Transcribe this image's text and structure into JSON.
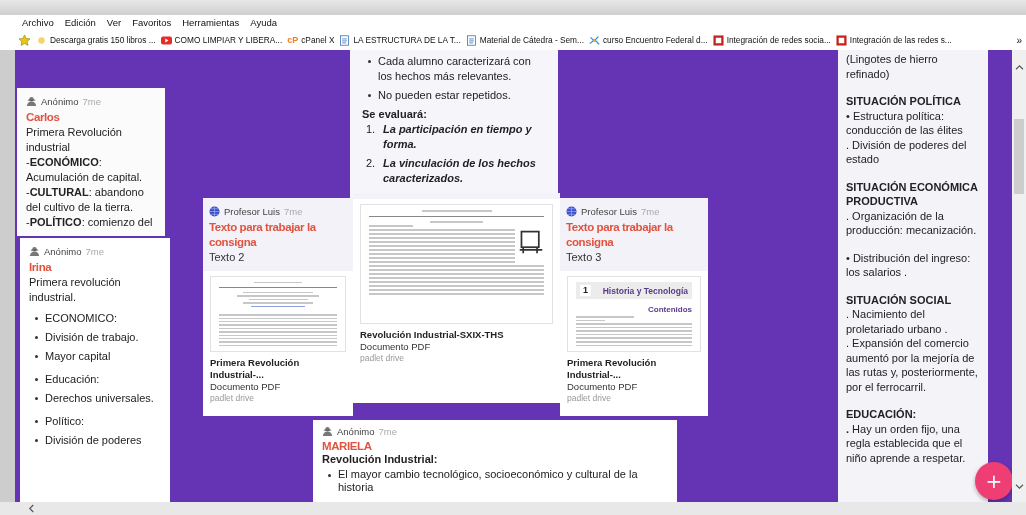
{
  "menu": [
    "Archivo",
    "Edición",
    "Ver",
    "Favoritos",
    "Herramientas",
    "Ayuda"
  ],
  "bookmarks": [
    {
      "kind": "folder",
      "label": "Descarga gratis 150 libros ..."
    },
    {
      "kind": "video",
      "label": "COMO LIMPIAR Y LIBERA..."
    },
    {
      "kind": "logo",
      "logo": "cP",
      "label": "cPanel X"
    },
    {
      "kind": "page",
      "label": "LA ESTRUCTURA DE LA T..."
    },
    {
      "kind": "page",
      "label": "Material de Cátedra - Sem..."
    },
    {
      "kind": "sparkle",
      "label": "curso Encuentro Federal d..."
    },
    {
      "kind": "square",
      "label": "Integración de redes socia..."
    },
    {
      "kind": "square",
      "label": "Integración de las redes s..."
    }
  ],
  "bookmarks_more": "»",
  "posts": [
    {
      "author": "Anónimo",
      "avatar": {
        "kind": "anonymous"
      },
      "time": "7me",
      "title": "Carlos",
      "body": [
        "Primera Revolución industrial",
        "-**ECONÓMICO**:",
        "Acumulación de capital.",
        "-**CULTURAL**: abandono del cultivo de la tierra.",
        "-**POLÍTICO**: comienzo del"
      ]
    },
    {
      "author": "Anónimo",
      "avatar": {
        "kind": "anonymous"
      },
      "time": "7me",
      "title": "Irina",
      "body": [
        "Primera revolución industrial."
      ],
      "bullet_groups": [
        [
          "ECONOMICO:",
          "División de trabajo.",
          "Mayor capital"
        ],
        [
          "Educación:",
          "Derechos universales."
        ],
        [
          "Político:",
          "División de poderes"
        ]
      ]
    },
    {
      "bullet_groups": [
        [
          "Cada alumno caracterizará con los hechos más relevantes.",
          "No pueden estar repetidos."
        ]
      ],
      "heading": "Se evaluará:",
      "numbered": [
        {
          "number": "1.",
          "text": "La participación en tiempo y forma."
        },
        {
          "number": "2.",
          "text": "La vinculación de los hechos caracterizados."
        }
      ]
    },
    {
      "author": "Profesor Luis",
      "avatar": {
        "kind": "teacher"
      },
      "time": "7me",
      "title": "Texto para trabajar la consigna",
      "subtitle": "Texto 2",
      "file": {
        "thumbnail": {
          "kind": "plain"
        },
        "name": "Primera Revolución Industrial-...",
        "type": "Documento PDF",
        "source": "padlet drive"
      }
    },
    {
      "file": {
        "thumbnail": {
          "kind": "drawing"
        },
        "name": "Revolución Industrial-SXIX-THS",
        "type": "Documento PDF",
        "source": "padlet drive"
      }
    },
    {
      "author": "Profesor Luis",
      "avatar": {
        "kind": "teacher"
      },
      "time": "7me",
      "title": "Texto para trabajar la consigna",
      "subtitle": "Texto 3",
      "file": {
        "thumbnail": {
          "kind": "titled",
          "number": "1",
          "title": "Historia y Tecnología",
          "label": "Contenidos"
        },
        "name": "Primera Revolución Industrial-...",
        "type": "Documento PDF",
        "source": "padlet drive"
      }
    },
    {
      "author": "Anónimo",
      "avatar": {
        "kind": "anonymous"
      },
      "time": "7me",
      "title": "MARIELA",
      "lead": "Revolución Industrial:",
      "bullet_groups": [
        [
          "El mayor cambio tecnológico, socioeconómico y cultural de la historia"
        ]
      ]
    },
    {
      "blocks": [
        {
          "kind": "text",
          "lines": [
            "(Lingotes de hierro refinado)"
          ]
        },
        {
          "kind": "heading",
          "lines": [
            "SITUACIÓN POLÍTICA"
          ]
        },
        {
          "kind": "text",
          "lines": [
            "• Estructura política: conducción de las élites",
            ". División de poderes del estado"
          ]
        },
        {
          "kind": "heading",
          "lines": [
            "SITUACIÓN ECONÓMICA PRODUCTIVA"
          ]
        },
        {
          "kind": "text",
          "lines": [
            ". Organización de la producción: mecanización."
          ]
        },
        {
          "kind": "text",
          "lines": [
            "• Distribución del ingreso: los salarios ."
          ]
        },
        {
          "kind": "heading",
          "lines": [
            "SITUACIÓN SOCIAL"
          ]
        },
        {
          "kind": "text",
          "lines": [
            ". Nacimiento del proletariado urbano .",
            ". Expansión del comercio aumentó por la mejoría de las rutas y, posteriormente, por el ferrocarril."
          ]
        },
        {
          "kind": "heading",
          "lines": [
            "EDUCACIÓN:"
          ]
        },
        {
          "kind": "text",
          "lines": [
            "**.** Hay un orden fijo, una regla establecida que el niño aprende a respetar."
          ]
        }
      ]
    }
  ],
  "add_button": "+"
}
